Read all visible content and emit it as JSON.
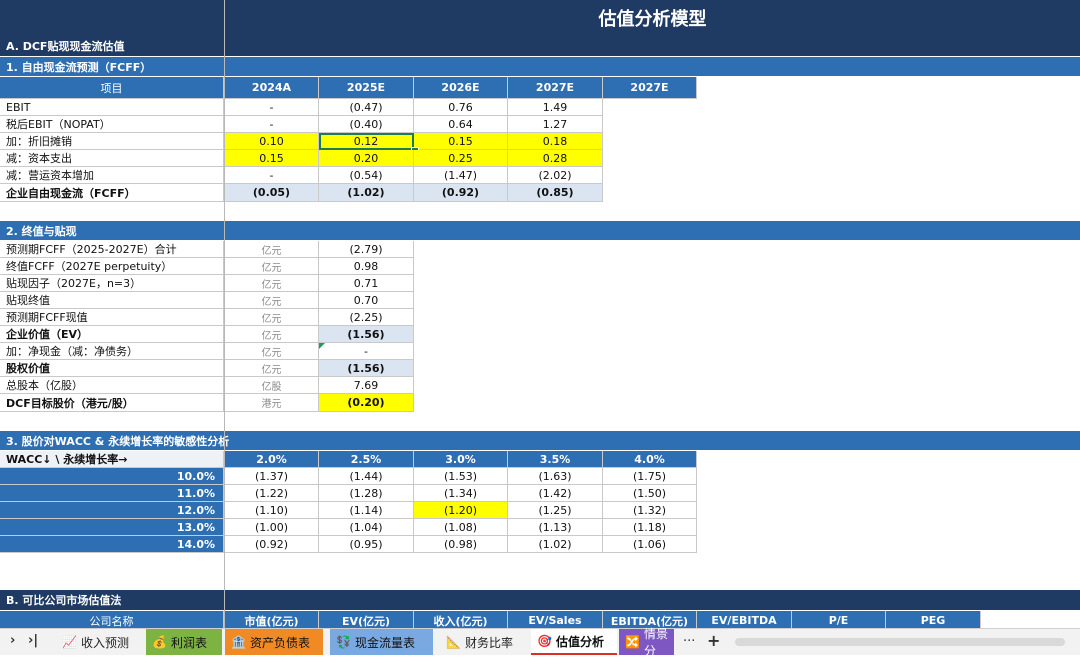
{
  "sheet_title": "估值分析模型",
  "section_a": "A. DCF贴现现金流估值",
  "fcff": {
    "heading": "1. 自由现金流预测（FCFF）",
    "header": [
      "项目",
      "2024A",
      "2025E",
      "2026E",
      "2027E",
      "2027E"
    ],
    "rows": [
      {
        "label": "EBIT",
        "values": [
          "-",
          "(0.47)",
          "0.76",
          "1.49"
        ]
      },
      {
        "label": "税后EBIT（NOPAT）",
        "values": [
          "-",
          "(0.40)",
          "0.64",
          "1.27"
        ]
      },
      {
        "label": "加：折旧摊销",
        "values": [
          "0.10",
          "0.12",
          "0.15",
          "0.18"
        ]
      },
      {
        "label": "减：资本支出",
        "values": [
          "0.15",
          "0.20",
          "0.25",
          "0.28"
        ]
      },
      {
        "label": "减：营运资本增加",
        "values": [
          "-",
          "(0.54)",
          "(1.47)",
          "(2.02)"
        ]
      },
      {
        "label": "企业自由现金流（FCFF）",
        "values": [
          "(0.05)",
          "(1.02)",
          "(0.92)",
          "(0.85)"
        ]
      }
    ]
  },
  "terminal": {
    "heading": "2. 终值与贴现",
    "rows": [
      {
        "label": "预测期FCFF（2025-2027E）合计",
        "unit": "亿元",
        "value": "(2.79)"
      },
      {
        "label": "终值FCFF（2027E perpetuity）",
        "unit": "亿元",
        "value": "0.98"
      },
      {
        "label": "贴现因子（2027E，n=3）",
        "unit": "亿元",
        "value": "0.71"
      },
      {
        "label": "贴现终值",
        "unit": "亿元",
        "value": "0.70"
      },
      {
        "label": "预测期FCFF现值",
        "unit": "亿元",
        "value": "(2.25)"
      },
      {
        "label": "企业价值（EV）",
        "unit": "亿元",
        "value": "(1.56)"
      },
      {
        "label": "加：净现金（减：净债务）",
        "unit": "亿元",
        "value": "-"
      },
      {
        "label": "股权价值",
        "unit": "亿元",
        "value": "(1.56)"
      },
      {
        "label": "总股本（亿股）",
        "unit": "亿股",
        "value": "7.69"
      },
      {
        "label": "DCF目标股价（港元/股）",
        "unit": "港元",
        "value": "(0.20)"
      }
    ]
  },
  "sensitivity": {
    "heading": "3. 股价对WACC & 永续增长率的敏感性分析",
    "corner": "WACC↓ \\ 永续增长率→",
    "growth": [
      "2.0%",
      "2.5%",
      "3.0%",
      "3.5%",
      "4.0%"
    ],
    "rows": [
      {
        "wacc": "10.0%",
        "values": [
          "(1.37)",
          "(1.44)",
          "(1.53)",
          "(1.63)",
          "(1.75)"
        ]
      },
      {
        "wacc": "11.0%",
        "values": [
          "(1.22)",
          "(1.28)",
          "(1.34)",
          "(1.42)",
          "(1.50)"
        ]
      },
      {
        "wacc": "12.0%",
        "values": [
          "(1.10)",
          "(1.14)",
          "(1.20)",
          "(1.25)",
          "(1.32)"
        ]
      },
      {
        "wacc": "13.0%",
        "values": [
          "(1.00)",
          "(1.04)",
          "(1.08)",
          "(1.13)",
          "(1.18)"
        ]
      },
      {
        "wacc": "14.0%",
        "values": [
          "(0.92)",
          "(0.95)",
          "(0.98)",
          "(1.02)",
          "(1.06)"
        ]
      }
    ]
  },
  "section_b": "B. 可比公司市场估值法",
  "comps_header": [
    "公司名称",
    "市值(亿元)",
    "EV(亿元)",
    "收入(亿元)",
    "EV/Sales",
    "EBITDA(亿元)",
    "EV/EBITDA",
    "P/E",
    "PEG"
  ],
  "tabs": [
    {
      "icon": "📈",
      "label": "收入预测"
    },
    {
      "icon": "💰",
      "label": "利润表"
    },
    {
      "icon": "🏦",
      "label": "资产负债表"
    },
    {
      "icon": "💱",
      "label": "现金流量表"
    },
    {
      "icon": "📐",
      "label": "财务比率"
    },
    {
      "icon": "🎯",
      "label": "估值分析"
    },
    {
      "icon": "🔀",
      "label": "情景分"
    }
  ],
  "tab_nav": {
    "next": "›",
    "last": "›|",
    "more": "···",
    "add": "+"
  },
  "colors": {
    "navy": "#1f3a63",
    "header_blue": "#2e6fb3",
    "highlight": "#ffff00",
    "total": "#dbe5f1"
  }
}
